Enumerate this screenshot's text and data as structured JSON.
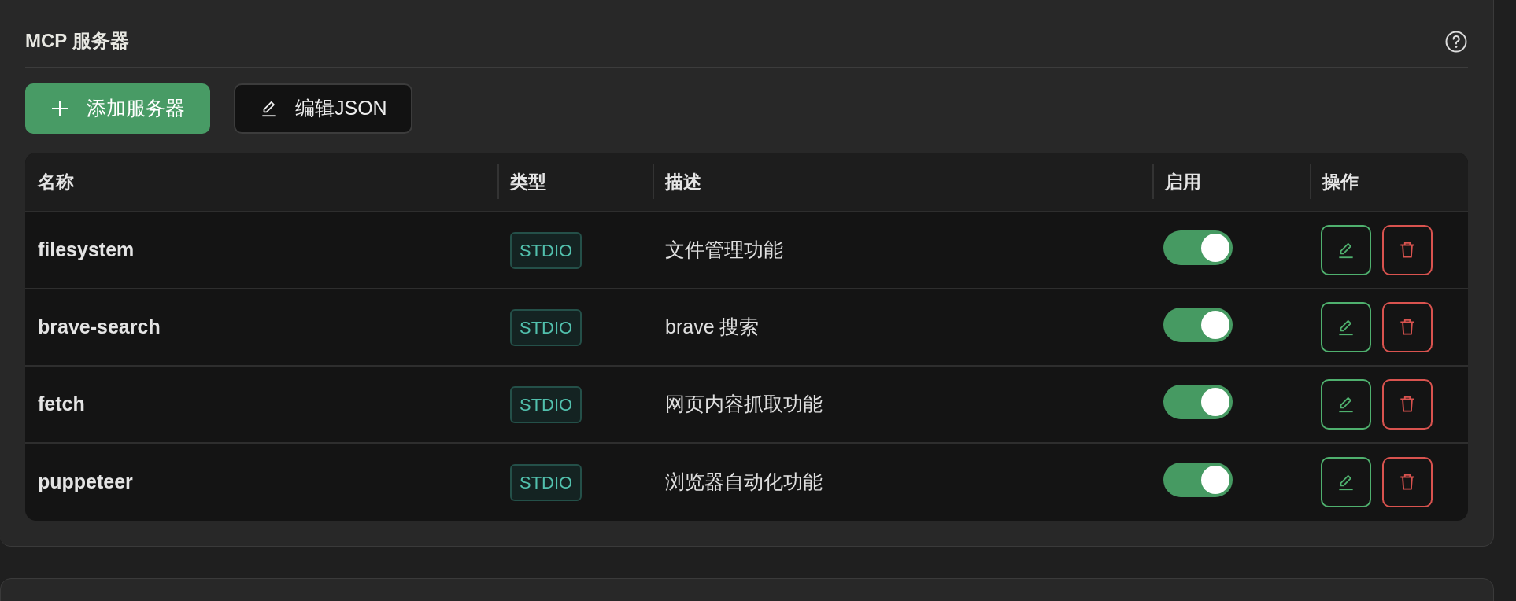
{
  "panel": {
    "title": "MCP 服务器"
  },
  "toolbar": {
    "buttons": [
      {
        "kind": "add",
        "label": "添加服务器"
      },
      {
        "kind": "edit",
        "label": "编辑JSON"
      }
    ]
  },
  "table": {
    "columns": [
      "名称",
      "类型",
      "描述",
      "启用",
      "操作"
    ],
    "rows": [
      {
        "name": "filesystem",
        "type": "STDIO",
        "description": "文件管理功能",
        "enabled": true
      },
      {
        "name": "brave-search",
        "type": "STDIO",
        "description": "brave 搜索",
        "enabled": true
      },
      {
        "name": "fetch",
        "type": "STDIO",
        "description": "网页内容抓取功能",
        "enabled": true
      },
      {
        "name": "puppeteer",
        "type": "STDIO",
        "description": "浏览器自动化功能",
        "enabled": true
      }
    ]
  }
}
